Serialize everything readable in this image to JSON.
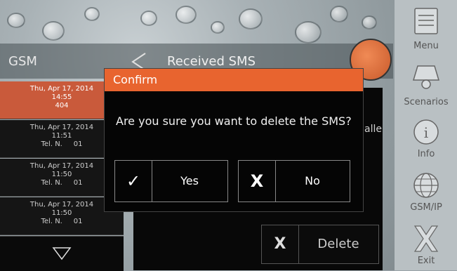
{
  "header": {
    "left_title": "GSM",
    "right_title": "Received SMS"
  },
  "sms_list": [
    {
      "date": "Thu, Apr 17, 2014",
      "time": "14:55",
      "from": "404",
      "selected": true
    },
    {
      "date": "Thu, Apr 17, 2014",
      "time": "11:51",
      "from": "Tel. N.     01",
      "selected": false
    },
    {
      "date": "Thu, Apr 17, 2014",
      "time": "11:50",
      "from": "Tel. N.     01",
      "selected": false
    },
    {
      "date": "Thu, Apr 17, 2014",
      "time": "11:50",
      "from": "Tel. N.     01",
      "selected": false
    }
  ],
  "detail": {
    "partial_text": "alle",
    "delete_icon": "X",
    "delete_label": "Delete"
  },
  "sidebar": [
    {
      "label": "Menu",
      "icon": "menu-icon"
    },
    {
      "label": "Scenarios",
      "icon": "scenarios-icon"
    },
    {
      "label": "Info",
      "icon": "info-icon"
    },
    {
      "label": "GSM/IP",
      "icon": "globe-icon"
    },
    {
      "label": "Exit",
      "icon": "exit-icon"
    }
  ],
  "dialog": {
    "title": "Confirm",
    "message": "Are you sure you want to delete the SMS?",
    "yes_icon": "✓",
    "yes_label": "Yes",
    "no_icon": "X",
    "no_label": "No"
  },
  "colors": {
    "accent": "#e8642f",
    "selected_item": "#c95a3b"
  }
}
